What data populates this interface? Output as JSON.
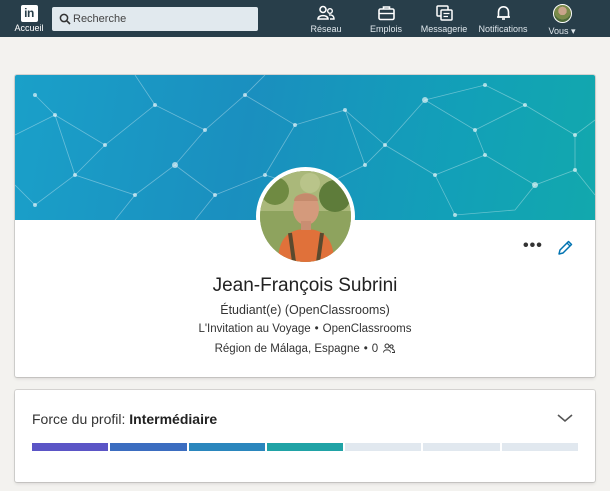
{
  "nav": {
    "home_label": "Accueil",
    "logo_text": "in",
    "search_placeholder": "Recherche",
    "items": [
      {
        "label": "Réseau",
        "icon": "network-icon"
      },
      {
        "label": "Emplois",
        "icon": "briefcase-icon"
      },
      {
        "label": "Messagerie",
        "icon": "messaging-icon"
      },
      {
        "label": "Notifications",
        "icon": "bell-icon"
      },
      {
        "label": "Vous ▾",
        "icon": "avatar"
      }
    ]
  },
  "profile": {
    "name": "Jean-François Subrini",
    "headline": "Étudiant(e) (OpenClassrooms)",
    "company": "L'Invitation au Voyage",
    "school": "OpenClassrooms",
    "location": "Région de Málaga, Espagne",
    "connections": "0",
    "bullet": "•",
    "more_label": "•••"
  },
  "strength": {
    "label": "Force du profil:",
    "level": "Intermédiaire",
    "filled_segments": 4,
    "total_segments": 7,
    "segment_colors": [
      "#5b55c6",
      "#3b6dc0",
      "#2a86bd",
      "#20a3a6"
    ],
    "empty_color": "#e1e8ef"
  },
  "colors": {
    "nav_bg": "#283e4a",
    "accent": "#0073b1"
  }
}
